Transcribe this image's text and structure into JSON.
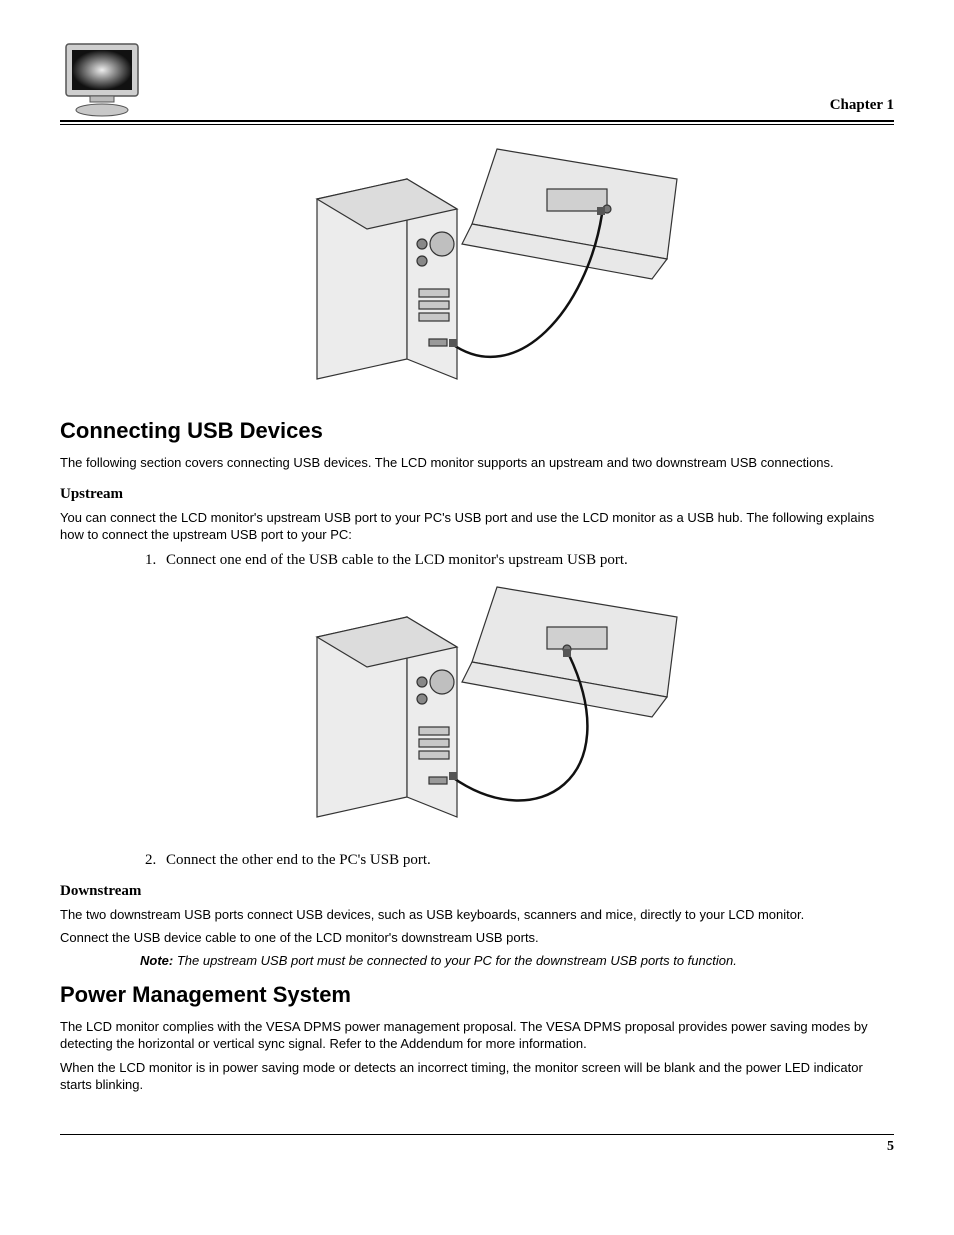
{
  "header": {
    "chapter": "Chapter 1"
  },
  "section1": {
    "title": "Connecting USB Devices",
    "intro": "The following section covers connecting USB devices. The LCD monitor supports an upstream and two downstream USB connections.",
    "upstream_head": "Upstream",
    "upstream_text": "You can connect the LCD monitor's upstream USB port to your PC's USB port and use the LCD monitor as a USB hub. The following explains how to connect the upstream USB port to your PC:",
    "step1": "Connect one end of the USB cable to the LCD monitor's upstream USB port.",
    "step2": "Connect the other end to the PC's USB port.",
    "downstream_head": "Downstream",
    "downstream_text": "The two downstream USB ports connect USB devices, such as USB keyboards, scanners and mice, directly to your LCD monitor.",
    "downstream_text2": "Connect the USB device cable to one of the LCD monitor's downstream USB ports.",
    "note_label": "Note:",
    "note_text": " The upstream USB port must be connected to your PC for the downstream USB ports to function."
  },
  "section2": {
    "title": "Power Management System",
    "p1": "The LCD monitor complies with the VESA DPMS power management proposal. The VESA DPMS proposal provides power saving modes by detecting the horizontal or vertical sync signal. Refer to the Addendum for more information.",
    "p2": "When the LCD monitor is in power saving mode or detects an incorrect timing, the monitor screen will be blank and the power LED indicator starts blinking."
  },
  "footer": {
    "page": "5"
  }
}
